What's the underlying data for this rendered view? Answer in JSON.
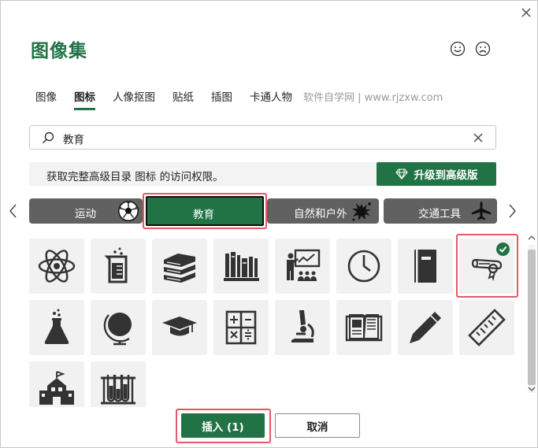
{
  "dialog": {
    "title": "图像集",
    "close_icon": "close-icon",
    "feedback": {
      "smile_icon": "smile-icon",
      "frown_icon": "frown-icon"
    }
  },
  "tabs": [
    {
      "label": "图像",
      "active": false
    },
    {
      "label": "图标",
      "active": true
    },
    {
      "label": "人像抠图",
      "active": false
    },
    {
      "label": "贴纸",
      "active": false
    },
    {
      "label": "插图",
      "active": false
    },
    {
      "label": "卡通人物",
      "active": false
    }
  ],
  "watermark": "软件自学网 | www.rjzxw.com",
  "search": {
    "value": "教育",
    "icon": "search-icon",
    "clear_icon": "clear-icon"
  },
  "banner": {
    "text": "获取完整高级目录 图标 的访问权限。",
    "upgrade_label": "升级到高级版",
    "upgrade_icon": "diamond-icon"
  },
  "categories": [
    {
      "label": "运动",
      "icon": "soccer-ball-icon",
      "selected": false
    },
    {
      "label": "教育",
      "icon": "",
      "selected": true
    },
    {
      "label": "自然和户外",
      "icon": "paint-splash-icon",
      "selected": false
    },
    {
      "label": "交通工具",
      "icon": "airplane-icon",
      "selected": false
    }
  ],
  "icons": [
    {
      "name": "atom-icon",
      "selected": false
    },
    {
      "name": "beaker-icon",
      "selected": false
    },
    {
      "name": "books-stack-icon",
      "selected": false
    },
    {
      "name": "books-shelf-icon",
      "selected": false
    },
    {
      "name": "teacher-presentation-icon",
      "selected": false
    },
    {
      "name": "clock-icon",
      "selected": false
    },
    {
      "name": "notebook-icon",
      "selected": false
    },
    {
      "name": "diploma-icon",
      "selected": true
    },
    {
      "name": "flask-icon",
      "selected": false
    },
    {
      "name": "globe-icon",
      "selected": false
    },
    {
      "name": "graduation-cap-icon",
      "selected": false
    },
    {
      "name": "calculator-icon",
      "selected": false
    },
    {
      "name": "microscope-icon",
      "selected": false
    },
    {
      "name": "open-book-icon",
      "selected": false
    },
    {
      "name": "pencil-icon",
      "selected": false
    },
    {
      "name": "ruler-icon",
      "selected": false
    },
    {
      "name": "school-building-icon",
      "selected": false
    },
    {
      "name": "test-tubes-icon",
      "selected": false
    }
  ],
  "footer": {
    "insert_label": "插入 (1)",
    "cancel_label": "取消"
  },
  "colors": {
    "accent": "#217346",
    "highlight": "#e35a64",
    "tile_bg": "#f1f1f1",
    "category_bg": "#616161",
    "icon": "#333333"
  }
}
